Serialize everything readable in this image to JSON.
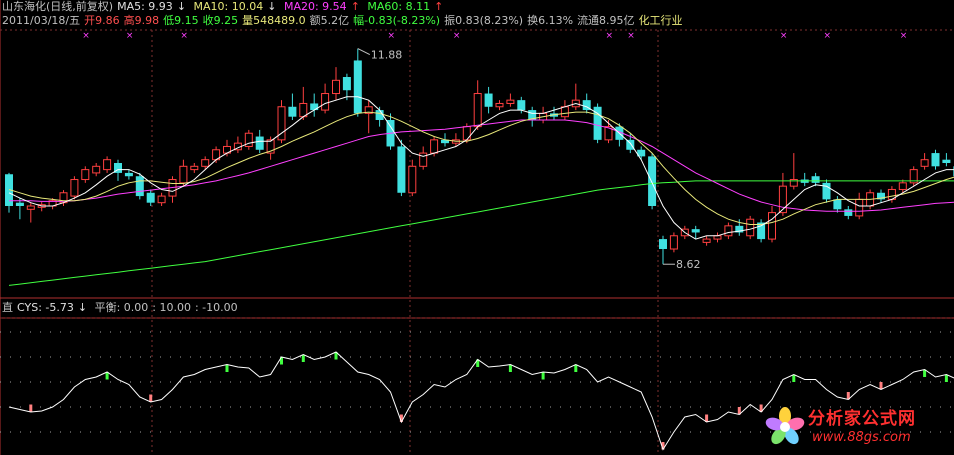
{
  "header": {
    "stock_name": "山东海化(日线,前复权)",
    "ma5": "MA5: 9.93",
    "ma10": "MA10: 10.04",
    "ma20": "MA20: 9.54",
    "ma60": "MA60: 8.11",
    "date": "2011/03/18/五",
    "open": "开9.86",
    "high": "高9.98",
    "low": "低9.15",
    "close": "收9.25",
    "volume": "量548489.0",
    "amount": "额5.2亿",
    "change": "幅-0.83(-8.23%)",
    "amplitude": "振0.83(8.23%)",
    "turnover": "换6.13%",
    "float_cap": "流通8.95亿",
    "industry": "化工行业"
  },
  "indicator": {
    "name": "直",
    "cys": "CYS: -5.73",
    "balance": "平衡: 0.00",
    "upper": ": 10.00",
    "lower": ": -10.00"
  },
  "annotations": {
    "high_label": "11.88",
    "low_label": "8.62"
  },
  "logo": {
    "text": "分析家公式网",
    "url": "www.88gs.com"
  },
  "colors": {
    "up": "#ff4040",
    "down": "#40e0e0",
    "ma5": "#ffffff",
    "ma10": "#e8e87a",
    "ma20": "#ff40ff",
    "ma60": "#40ff40",
    "cys_line": "#ffffff",
    "cys_pos_bar": "#40ff40",
    "cys_neg_bar": "#ff8080"
  },
  "chart_data": {
    "type": "candlestick",
    "ylim": [
      8.2,
      12.1
    ],
    "candles": [
      [
        9.98,
        9.5,
        10.0,
        9.4
      ],
      [
        9.55,
        9.5,
        9.62,
        9.3
      ],
      [
        9.45,
        9.5,
        9.55,
        9.25
      ],
      [
        9.48,
        9.52,
        9.56,
        9.42
      ],
      [
        9.5,
        9.58,
        9.62,
        9.45
      ],
      [
        9.55,
        9.7,
        9.74,
        9.5
      ],
      [
        9.65,
        9.9,
        9.95,
        9.6
      ],
      [
        9.9,
        10.05,
        10.1,
        9.85
      ],
      [
        10.0,
        10.1,
        10.15,
        9.95
      ],
      [
        10.05,
        10.2,
        10.25,
        10.0
      ],
      [
        10.15,
        10.0,
        10.2,
        9.88
      ],
      [
        10.0,
        9.95,
        10.05,
        9.9
      ],
      [
        9.95,
        9.65,
        10.0,
        9.6
      ],
      [
        9.7,
        9.55,
        9.75,
        9.5
      ],
      [
        9.55,
        9.65,
        9.7,
        9.5
      ],
      [
        9.65,
        9.9,
        9.95,
        9.55
      ],
      [
        9.85,
        10.1,
        10.2,
        9.8
      ],
      [
        10.05,
        10.1,
        10.15,
        10.0
      ],
      [
        10.1,
        10.2,
        10.25,
        10.05
      ],
      [
        10.2,
        10.35,
        10.4,
        10.15
      ],
      [
        10.3,
        10.4,
        10.5,
        10.25
      ],
      [
        10.35,
        10.45,
        10.55,
        10.3
      ],
      [
        10.4,
        10.6,
        10.65,
        10.35
      ],
      [
        10.55,
        10.35,
        10.65,
        10.3
      ],
      [
        10.3,
        10.5,
        10.55,
        10.2
      ],
      [
        10.5,
        11.0,
        11.1,
        10.45
      ],
      [
        11.0,
        10.85,
        11.2,
        10.8
      ],
      [
        10.85,
        11.05,
        11.3,
        10.8
      ],
      [
        11.05,
        10.95,
        11.2,
        10.85
      ],
      [
        10.95,
        11.2,
        11.35,
        10.9
      ],
      [
        11.2,
        11.4,
        11.6,
        11.1
      ],
      [
        11.45,
        11.25,
        11.5,
        11.1
      ],
      [
        11.7,
        10.9,
        11.88,
        10.85
      ],
      [
        10.9,
        11.0,
        11.1,
        10.6
      ],
      [
        10.95,
        10.8,
        11.0,
        10.7
      ],
      [
        10.8,
        10.4,
        10.9,
        10.35
      ],
      [
        10.4,
        9.7,
        10.5,
        9.65
      ],
      [
        9.7,
        10.1,
        10.2,
        9.65
      ],
      [
        10.1,
        10.3,
        10.4,
        10.05
      ],
      [
        10.3,
        10.5,
        10.55,
        10.25
      ],
      [
        10.5,
        10.45,
        10.6,
        10.4
      ],
      [
        10.45,
        10.5,
        10.6,
        10.4
      ],
      [
        10.5,
        10.7,
        10.75,
        10.45
      ],
      [
        10.7,
        11.2,
        11.4,
        10.65
      ],
      [
        11.2,
        11.0,
        11.3,
        10.9
      ],
      [
        11.0,
        11.05,
        11.1,
        10.95
      ],
      [
        11.05,
        11.1,
        11.2,
        11.0
      ],
      [
        11.1,
        10.95,
        11.15,
        10.9
      ],
      [
        10.95,
        10.8,
        11.0,
        10.7
      ],
      [
        10.8,
        10.9,
        11.0,
        10.75
      ],
      [
        10.9,
        10.85,
        11.0,
        10.8
      ],
      [
        10.85,
        11.0,
        11.1,
        10.8
      ],
      [
        11.0,
        11.1,
        11.35,
        10.95
      ],
      [
        11.1,
        10.95,
        11.2,
        10.9
      ],
      [
        11.0,
        10.5,
        11.05,
        10.45
      ],
      [
        10.5,
        10.7,
        10.8,
        10.45
      ],
      [
        10.7,
        10.5,
        10.75,
        10.4
      ],
      [
        10.5,
        10.35,
        10.6,
        10.3
      ],
      [
        10.35,
        10.25,
        10.4,
        10.2
      ],
      [
        10.25,
        9.5,
        10.3,
        9.45
      ],
      [
        9.0,
        8.85,
        9.05,
        8.62
      ],
      [
        8.85,
        9.05,
        9.1,
        8.8
      ],
      [
        9.05,
        9.15,
        9.2,
        9.0
      ],
      [
        9.15,
        9.1,
        9.2,
        9.0
      ],
      [
        8.95,
        9.0,
        9.05,
        8.9
      ],
      [
        9.0,
        9.05,
        9.1,
        8.95
      ],
      [
        9.05,
        9.2,
        9.25,
        9.0
      ],
      [
        9.2,
        9.1,
        9.3,
        9.05
      ],
      [
        9.05,
        9.3,
        9.35,
        9.0
      ],
      [
        9.25,
        9.0,
        9.3,
        8.95
      ],
      [
        9.0,
        9.4,
        9.5,
        8.95
      ],
      [
        9.4,
        9.8,
        10.0,
        9.35
      ],
      [
        9.8,
        9.9,
        10.3,
        9.75
      ],
      [
        9.9,
        9.85,
        10.0,
        9.8
      ],
      [
        9.95,
        9.85,
        10.0,
        9.8
      ],
      [
        9.85,
        9.6,
        9.9,
        9.55
      ],
      [
        9.6,
        9.45,
        9.65,
        9.4
      ],
      [
        9.45,
        9.35,
        9.5,
        9.3
      ],
      [
        9.35,
        9.6,
        9.7,
        9.3
      ],
      [
        9.5,
        9.7,
        9.75,
        9.45
      ],
      [
        9.7,
        9.6,
        9.75,
        9.55
      ],
      [
        9.6,
        9.75,
        9.8,
        9.55
      ],
      [
        9.75,
        9.85,
        9.9,
        9.7
      ],
      [
        9.85,
        10.05,
        10.1,
        9.8
      ],
      [
        10.1,
        10.2,
        10.3,
        10.05
      ],
      [
        10.3,
        10.1,
        10.35,
        10.05
      ],
      [
        10.2,
        10.15,
        10.3,
        10.1
      ],
      [
        10.1,
        9.95,
        10.15,
        9.9
      ]
    ],
    "ma5": [
      9.7,
      9.62,
      9.55,
      9.5,
      9.5,
      9.55,
      9.62,
      9.7,
      9.82,
      9.95,
      10.05,
      10.05,
      9.98,
      9.85,
      9.75,
      9.72,
      9.8,
      9.9,
      10.05,
      10.2,
      10.3,
      10.38,
      10.45,
      10.48,
      10.48,
      10.6,
      10.72,
      10.85,
      10.95,
      11.05,
      11.1,
      11.15,
      11.15,
      11.1,
      10.95,
      10.7,
      10.45,
      10.3,
      10.25,
      10.3,
      10.35,
      10.4,
      10.5,
      10.7,
      10.8,
      10.9,
      10.95,
      10.95,
      10.9,
      10.9,
      10.95,
      11.0,
      11.05,
      11.0,
      10.9,
      10.75,
      10.6,
      10.45,
      10.2,
      9.85,
      9.5,
      9.25,
      9.1,
      9.0,
      9.05,
      9.05,
      9.1,
      9.12,
      9.15,
      9.2,
      9.3,
      9.45,
      9.6,
      9.75,
      9.82,
      9.8,
      9.7,
      9.58,
      9.5,
      9.5,
      9.55,
      9.6,
      9.7,
      9.8,
      9.9,
      10.0,
      10.05,
      10.05
    ],
    "ma10": [
      9.75,
      9.7,
      9.65,
      9.62,
      9.6,
      9.58,
      9.58,
      9.6,
      9.65,
      9.72,
      9.8,
      9.85,
      9.88,
      9.88,
      9.86,
      9.84,
      9.84,
      9.87,
      9.92,
      10.0,
      10.08,
      10.15,
      10.22,
      10.28,
      10.33,
      10.4,
      10.48,
      10.55,
      10.62,
      10.7,
      10.78,
      10.85,
      10.9,
      10.92,
      10.9,
      10.85,
      10.78,
      10.7,
      10.62,
      10.55,
      10.5,
      10.48,
      10.48,
      10.52,
      10.58,
      10.65,
      10.72,
      10.78,
      10.82,
      10.85,
      10.88,
      10.9,
      10.92,
      10.92,
      10.88,
      10.82,
      10.72,
      10.6,
      10.45,
      10.3,
      10.1,
      9.92,
      9.75,
      9.6,
      9.48,
      9.38,
      9.3,
      9.25,
      9.22,
      9.22,
      9.25,
      9.3,
      9.38,
      9.45,
      9.52,
      9.56,
      9.6,
      9.6,
      9.6,
      9.6,
      9.62,
      9.65,
      9.68,
      9.72,
      9.78,
      9.84,
      9.9,
      9.95
    ],
    "ma20": [
      9.58,
      9.58,
      9.58,
      9.57,
      9.57,
      9.57,
      9.58,
      9.6,
      9.62,
      9.65,
      9.68,
      9.7,
      9.72,
      9.74,
      9.76,
      9.78,
      9.8,
      9.82,
      9.85,
      9.88,
      9.92,
      9.96,
      10.0,
      10.05,
      10.1,
      10.15,
      10.2,
      10.25,
      10.3,
      10.35,
      10.4,
      10.45,
      10.5,
      10.55,
      10.58,
      10.6,
      10.62,
      10.63,
      10.64,
      10.65,
      10.66,
      10.68,
      10.7,
      10.72,
      10.74,
      10.76,
      10.78,
      10.8,
      10.8,
      10.8,
      10.8,
      10.8,
      10.78,
      10.76,
      10.72,
      10.68,
      10.62,
      10.55,
      10.48,
      10.4,
      10.3,
      10.2,
      10.1,
      10.0,
      9.92,
      9.84,
      9.76,
      9.68,
      9.62,
      9.56,
      9.52,
      9.48,
      9.46,
      9.44,
      9.43,
      9.42,
      9.42,
      9.42,
      9.42,
      9.43,
      9.44,
      9.46,
      9.48,
      9.5,
      9.52,
      9.54,
      9.55,
      9.56
    ],
    "ma60": [
      8.3,
      8.32,
      8.34,
      8.36,
      8.38,
      8.4,
      8.42,
      8.44,
      8.46,
      8.48,
      8.5,
      8.52,
      8.54,
      8.56,
      8.58,
      8.6,
      8.62,
      8.64,
      8.66,
      8.69,
      8.72,
      8.75,
      8.78,
      8.81,
      8.84,
      8.87,
      8.9,
      8.93,
      8.96,
      8.99,
      9.02,
      9.05,
      9.08,
      9.11,
      9.14,
      9.17,
      9.2,
      9.23,
      9.26,
      9.29,
      9.32,
      9.35,
      9.38,
      9.41,
      9.44,
      9.47,
      9.5,
      9.53,
      9.56,
      9.59,
      9.62,
      9.65,
      9.68,
      9.71,
      9.74,
      9.76,
      9.78,
      9.8,
      9.82,
      9.84,
      9.85,
      9.86,
      9.87,
      9.88,
      9.88,
      9.88,
      9.88,
      9.88,
      9.88,
      9.88,
      9.88,
      9.88,
      9.88,
      9.88,
      9.88,
      9.88,
      9.88,
      9.88,
      9.88,
      9.88,
      9.88,
      9.88,
      9.88,
      9.88,
      9.88,
      9.88,
      9.88,
      9.88
    ],
    "cys_ylim": [
      -14,
      12
    ],
    "cys": [
      -5,
      -5.5,
      -6,
      -5.8,
      -5,
      -3.5,
      -1,
      0.5,
      1,
      2,
      0.5,
      -0.5,
      -3,
      -4,
      -3.5,
      -1.5,
      1,
      1.5,
      2.5,
      3,
      3.5,
      3,
      2.8,
      1,
      1.5,
      5,
      4.5,
      5.5,
      4.5,
      5,
      6,
      4,
      2,
      1.5,
      0.5,
      -2,
      -8,
      -4,
      -2.5,
      -0.5,
      -1,
      0.5,
      1.5,
      4.5,
      3,
      3.2,
      3.5,
      2.5,
      1.5,
      2,
      1.8,
      2.5,
      3.5,
      2.5,
      0,
      1,
      0,
      -1,
      -2,
      -7,
      -13.5,
      -10,
      -7,
      -6.5,
      -8,
      -7.5,
      -6,
      -6.5,
      -4.5,
      -6,
      -3.5,
      0.5,
      1.5,
      0.5,
      0.5,
      -1.5,
      -3,
      -3.5,
      -1.5,
      -0.5,
      -1.5,
      -0.5,
      0.5,
      2,
      2.5,
      1,
      1.5,
      0.5
    ]
  }
}
